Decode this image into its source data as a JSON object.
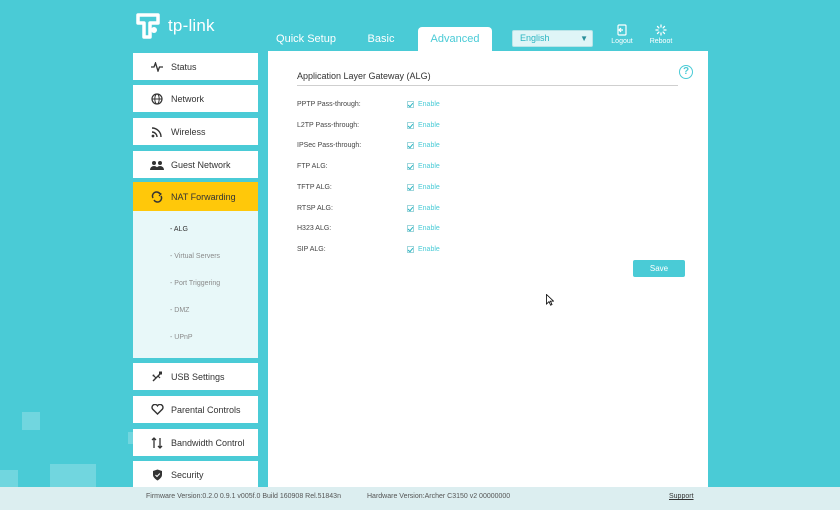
{
  "header": {
    "brand": "tp-link",
    "tabs": [
      {
        "label": "Quick Setup"
      },
      {
        "label": "Basic"
      },
      {
        "label": "Advanced",
        "active": true
      }
    ],
    "language": {
      "selected": "English"
    },
    "logout_label": "Logout",
    "reboot_label": "Reboot"
  },
  "sidebar": {
    "items": [
      {
        "label": "Status",
        "icon": "status-pulse-icon"
      },
      {
        "label": "Network",
        "icon": "globe-icon"
      },
      {
        "label": "Wireless",
        "icon": "wifi-icon"
      },
      {
        "label": "Guest Network",
        "icon": "guest-users-icon"
      },
      {
        "label": "NAT Forwarding",
        "icon": "nat-forwarding-icon",
        "active": true
      },
      {
        "label": "USB Settings",
        "icon": "usb-icon"
      },
      {
        "label": "Parental Controls",
        "icon": "heart-icon"
      },
      {
        "label": "Bandwidth Control",
        "icon": "bandwidth-arrows-icon"
      },
      {
        "label": "Security",
        "icon": "shield-icon"
      }
    ],
    "submenu": [
      {
        "label": "- ALG",
        "active": true
      },
      {
        "label": "- Virtual Servers"
      },
      {
        "label": "- Port Triggering"
      },
      {
        "label": "- DMZ"
      },
      {
        "label": "- UPnP"
      }
    ]
  },
  "main": {
    "section_title": "Application Layer Gateway (ALG)",
    "rows": [
      {
        "label": "PPTP Pass-through:",
        "checked": true,
        "option": "Enable"
      },
      {
        "label": "L2TP Pass-through:",
        "checked": true,
        "option": "Enable"
      },
      {
        "label": "IPSec Pass-through:",
        "checked": true,
        "option": "Enable"
      },
      {
        "label": "FTP ALG:",
        "checked": true,
        "option": "Enable"
      },
      {
        "label": "TFTP ALG:",
        "checked": true,
        "option": "Enable"
      },
      {
        "label": "RTSP ALG:",
        "checked": true,
        "option": "Enable"
      },
      {
        "label": "H323 ALG:",
        "checked": true,
        "option": "Enable"
      },
      {
        "label": "SIP ALG:",
        "checked": true,
        "option": "Enable"
      }
    ],
    "save_label": "Save"
  },
  "footer": {
    "firmware": "Firmware Version:0.2.0 0.9.1 v005f.0 Build 160908 Rel.51843n",
    "hardware": "Hardware Version:Archer C3150 v2 00000000",
    "support_label": "Support"
  },
  "colors": {
    "accent": "#4acbd6",
    "active_menu": "#ffc80a",
    "submenu_bg": "#e8f8f9",
    "footer_bg": "#dceef0"
  }
}
